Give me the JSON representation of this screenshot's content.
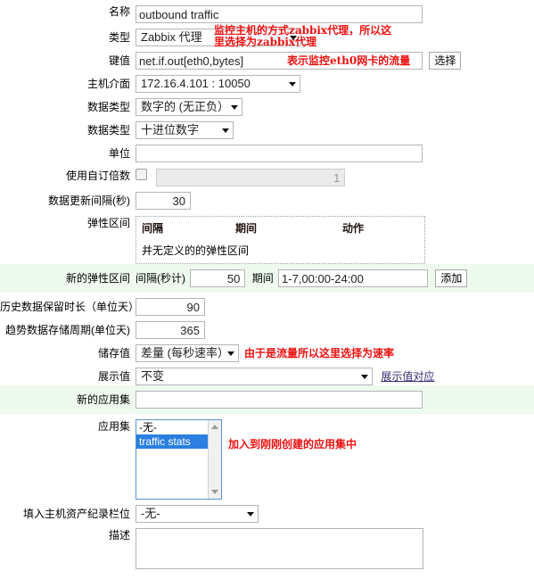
{
  "form": {
    "rows": {
      "name": {
        "label": "名称",
        "value": "outbound traffic"
      },
      "type": {
        "label": "类型",
        "value": "Zabbix 代理",
        "note": "监控主机的方式zabbix代理，所以这\n里选择为zabbix代理"
      },
      "key": {
        "label": "键值",
        "value": "net.if.out[eth0,bytes]",
        "note": "表示监控eth0网卡的流量",
        "button": "选择"
      },
      "host_interface": {
        "label": "主机介面",
        "value": "172.16.4.101 : 10050"
      },
      "value_type": {
        "label": "数据类型",
        "value": "数字的 (无正负）"
      },
      "data_type": {
        "label": "数据类型",
        "value": "十进位数字"
      },
      "units": {
        "label": "单位",
        "value": ""
      },
      "custom_multiplier": {
        "label": "使用自订倍数",
        "checked": false,
        "value": "1"
      },
      "update_interval": {
        "label": "数据更新间隔(秒)",
        "value": "30"
      },
      "flexible_intervals": {
        "label": "弹性区间",
        "headers": [
          "间隔",
          "期间",
          "动作"
        ],
        "empty_text": "并无定义的的弹性区间"
      },
      "new_flexible_interval": {
        "label": "新的弹性区间",
        "interval_label": "间隔(秒计)",
        "interval_value": "50",
        "period_label": "期间",
        "period_value": "1-7,00:00-24:00",
        "add_button": "添加"
      },
      "history": {
        "label": "历史数据保留时长（单位天）",
        "value": "90"
      },
      "trends": {
        "label": "趋势数据存储周期(单位天)",
        "value": "365"
      },
      "store_value": {
        "label": "储存值",
        "value": "差量 (每秒速率）",
        "note": "由于是流量所以这里选择为速率"
      },
      "show_value": {
        "label": "展示值",
        "value": "不变",
        "link": "展示值对应"
      },
      "new_application": {
        "label": "新的应用集",
        "value": ""
      },
      "applications": {
        "label": "应用集",
        "options": [
          "-无-",
          "traffic stats"
        ],
        "selected_index": 1,
        "note": "加入到刚刚创建的应用集中"
      },
      "inventory_field": {
        "label": "填入主机资产纪录栏位",
        "value": "-无-"
      },
      "description": {
        "label": "描述",
        "value": ""
      }
    }
  },
  "colors": {
    "note_red": "#ee1111",
    "row_shade": "#eefaee",
    "select_blue": "#2a7fe0",
    "link": "#3a2a72"
  }
}
